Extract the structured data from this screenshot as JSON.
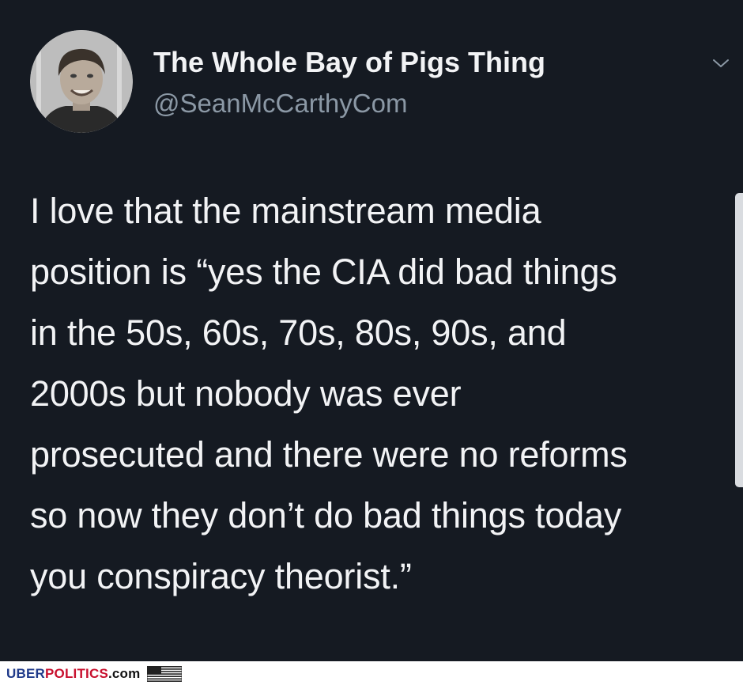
{
  "tweet": {
    "display_name": "The Whole Bay of Pigs Thing",
    "handle": "@SeanMcCarthyCom",
    "text": "I love that the mainstream media\nposition is “yes the CIA did bad things\nin the 50s, 60s, 70s, 80s, 90s, and\n2000s but nobody was ever\nprosecuted and there were no reforms\nso now they don’t do bad things today\nyou conspiracy theorist.”"
  },
  "footer": {
    "brand_part1": "UBER",
    "brand_part2": "POLITICS",
    "brand_part3": ".com"
  },
  "colors": {
    "background": "#151a22",
    "text": "#f2f3f5",
    "handle": "#8b98a5",
    "brand_blue": "#1f3a8a",
    "brand_red": "#c8102e"
  },
  "icons": {
    "menu": "chevron-down-icon",
    "flag": "us-flag-icon"
  }
}
